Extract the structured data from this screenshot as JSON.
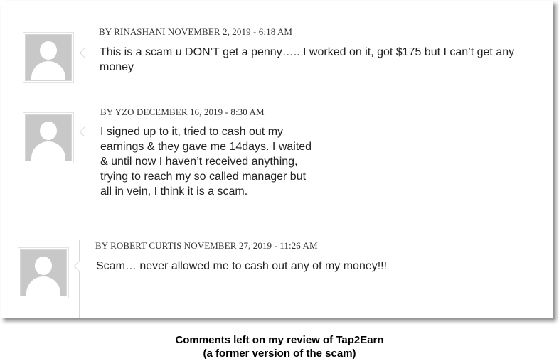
{
  "comments": [
    {
      "author_line": "BY RINASHANI NOVEMBER 2, 2019 - 6:18 AM",
      "body": "This is a scam u DON’T get a penny….. I worked on it, got $175 but I can’t get any money"
    },
    {
      "author_line": "BY YZO DECEMBER 16, 2019 - 8:30 AM",
      "body": "I signed up to it, tried to cash out my earnings & they gave me 14days. I waited & until now I haven’t received anything, trying to reach my so called manager but all in vein, I think it is a scam."
    },
    {
      "author_line": "BY ROBERT CURTIS NOVEMBER 27, 2019 - 11:26 AM",
      "body": "Scam… never allowed me to cash out any of my money!!!"
    }
  ],
  "caption": {
    "line1": "Comments left on my review of Tap2Earn",
    "line2": "(a former version of the scam)"
  },
  "icons": {
    "avatar": "default-user-avatar-icon"
  }
}
